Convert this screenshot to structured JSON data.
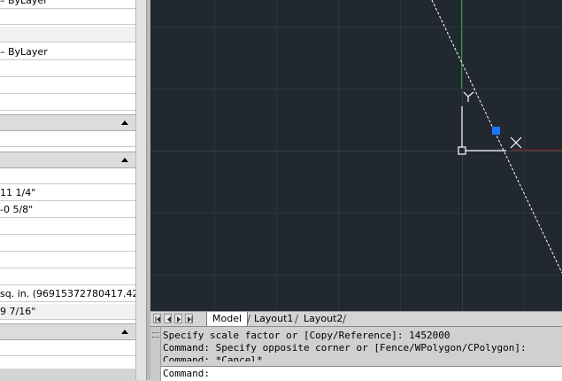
{
  "properties_palette": {
    "rows": [
      {
        "text": "– ByLayer",
        "style": "white"
      },
      {
        "text": "",
        "style": "white"
      },
      {
        "text": "",
        "style": "grey"
      },
      {
        "text": "– ByLayer",
        "style": "white"
      },
      {
        "text": "",
        "style": "white"
      },
      {
        "text": "",
        "style": "white"
      },
      {
        "text": "",
        "style": "white"
      },
      {
        "text": "",
        "style": "white"
      },
      {
        "text": "",
        "style": "white"
      },
      {
        "text": "",
        "style": "white"
      },
      {
        "text": "11 1/4\"",
        "style": "white"
      },
      {
        "text": "-0 5/8\"",
        "style": "white"
      },
      {
        "text": "",
        "style": "white"
      },
      {
        "text": "",
        "style": "white"
      },
      {
        "text": "",
        "style": "white"
      },
      {
        "text": "sq. in. (96915372780417.42...",
        "style": "white"
      },
      {
        "text": "9 7/16\"",
        "style": "grey"
      },
      {
        "text": "",
        "style": "white"
      },
      {
        "text": "",
        "style": "white"
      }
    ]
  },
  "layout_tabs": {
    "tabs": [
      "Model",
      "Layout1",
      "Layout2"
    ],
    "active": "Model"
  },
  "command_window": {
    "history": [
      "Specify scale factor or [Copy/Reference]: 1452000",
      "Command: Specify opposite corner or [Fence/WPolygon/CPolygon]:",
      "Command: *Cancel*"
    ],
    "prompt": "Command:"
  },
  "colors": {
    "canvas_bg": "#212830",
    "grid": "#2c343c",
    "y_axis": "#2ea043",
    "x_axis": "#8a2b2b",
    "grip": "#1e74ff"
  },
  "icons": [
    "first-layout-icon",
    "previous-layout-icon",
    "next-layout-icon",
    "last-layout-icon",
    "ucs-icon",
    "crosshair-cursor-icon",
    "grip-icon"
  ]
}
